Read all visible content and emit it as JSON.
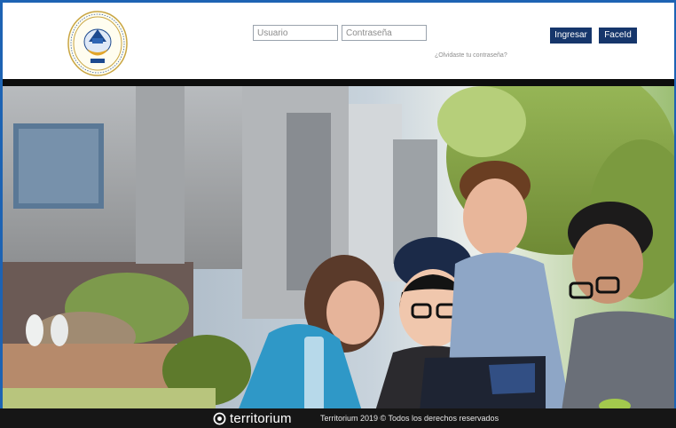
{
  "header": {
    "logo_icon": "university-seal-logo",
    "username_placeholder": "Usuario",
    "password_placeholder": "Contraseña",
    "forgot_password": "¿Olvidaste tu contraseña?",
    "login_button": "Ingresar",
    "faceid_button": "FaceId"
  },
  "hero": {
    "image": "students-laptop-campus-photo"
  },
  "footer": {
    "brand_icon": "territorium-logo-icon",
    "brand_name": "territorium",
    "copyright": "Territorium 2019 © Todos los derechos reservados"
  },
  "colors": {
    "frame_border": "#1d63b3",
    "button_bg": "#16366b",
    "footer_bg": "#161616"
  }
}
